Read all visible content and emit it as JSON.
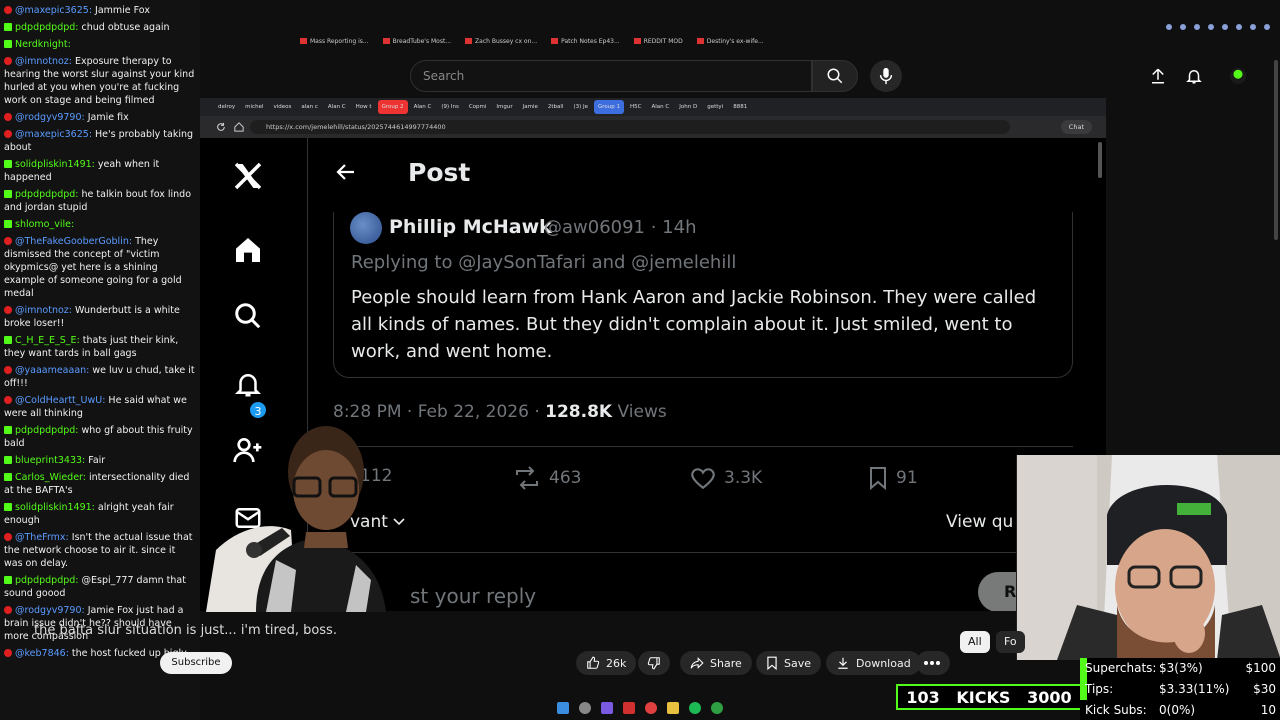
{
  "chat": [
    {
      "platform": "youtube",
      "user": "@maxepic3625:",
      "text": "Jammie Fox",
      "color": "#5b9bff"
    },
    {
      "platform": "kick",
      "user": "pdpdpdpdpd:",
      "text": "chud obtuse again",
      "color": "#53fc18"
    },
    {
      "platform": "kick",
      "user": "Nerdknight:",
      "text": "",
      "color": "#53fc18"
    },
    {
      "platform": "youtube",
      "user": "@imnotnoz:",
      "text": "Exposure therapy to hearing the worst slur against your kind hurled at you when you're at fucking work on stage and being filmed",
      "color": "#5b9bff"
    },
    {
      "platform": "youtube",
      "user": "@rodgyv9790:",
      "text": "Jamie fix",
      "color": "#5b9bff"
    },
    {
      "platform": "youtube",
      "user": "@maxepic3625:",
      "text": "He's probably taking about",
      "color": "#5b9bff"
    },
    {
      "platform": "kick",
      "user": "solidpliskin1491:",
      "text": "yeah when it happened",
      "color": "#53fc18"
    },
    {
      "platform": "kick",
      "user": "pdpdpdpdpd:",
      "text": "he talkin bout fox lindo and jordan stupid",
      "color": "#53fc18"
    },
    {
      "platform": "kick",
      "user": "shlomo_vile:",
      "text": "",
      "color": "#53fc18"
    },
    {
      "platform": "youtube",
      "user": "@TheFakeGooberGoblin:",
      "text": "They dismissed the concept of \"victim okypmics@ yet here is a shining example of someone going for a gold medal",
      "color": "#5b9bff"
    },
    {
      "platform": "youtube",
      "user": "@imnotnoz:",
      "text": "Wunderbutt is a white broke loser!!",
      "color": "#5b9bff"
    },
    {
      "platform": "kick",
      "user": "C_H_E_E_S_E:",
      "text": "thats just their kink, they want tards in ball gags",
      "color": "#53fc18"
    },
    {
      "platform": "youtube",
      "user": "@yaaameaaan:",
      "text": "we luv u chud, take it off!!!",
      "color": "#5b9bff"
    },
    {
      "platform": "youtube",
      "user": "@ColdHeartt_UwU:",
      "text": "He said what we were all thinking",
      "color": "#5b9bff"
    },
    {
      "platform": "kick",
      "user": "pdpdpdpdpd:",
      "text": "who gf about this fruity bald",
      "color": "#53fc18"
    },
    {
      "platform": "kick",
      "user": "blueprint3433:",
      "text": "Fair",
      "color": "#53fc18"
    },
    {
      "platform": "kick",
      "user": "Carlos_Wieder:",
      "text": "intersectionality died at the BAFTA's",
      "color": "#53fc18"
    },
    {
      "platform": "kick",
      "user": "solidpliskin1491:",
      "text": "alright yeah fair enough",
      "color": "#53fc18"
    },
    {
      "platform": "youtube",
      "user": "@TheFrmx:",
      "text": "Isn't the actual issue that the network choose to air it. since it was on delay.",
      "color": "#5b9bff"
    },
    {
      "platform": "kick",
      "user": "pdpdpdpdpd:",
      "text": "@Espi_777 damn that sound goood",
      "color": "#53fc18"
    },
    {
      "platform": "youtube",
      "user": "@rodgyv9790:",
      "text": "Jamie Fox just had a brain issue didn't he?? should have more compassion",
      "color": "#5b9bff"
    },
    {
      "platform": "youtube",
      "user": "@keb7846:",
      "text": "the host fucked up bigly",
      "color": "#5b9bff"
    }
  ],
  "youtube": {
    "search_placeholder": "Search",
    "caption": "the bafta slur situation is just... i'm tired, boss.",
    "subscribe": "Subscribe",
    "likes": "26k",
    "share": "Share",
    "save": "Save",
    "download": "Download",
    "pill_all": "All",
    "pill_fo": "Fo",
    "bookmarks": [
      "Mass Reporting is...",
      "BreadTube's Most...",
      "Zach Bussey cx on...",
      "Patch Notes Ep43...",
      "REDDIT MOD",
      "Destiny's ex-wife..."
    ]
  },
  "browser": {
    "tabs": [
      {
        "label": "delroy",
        "style": ""
      },
      {
        "label": "michel",
        "style": ""
      },
      {
        "label": "videos",
        "style": ""
      },
      {
        "label": "alan c",
        "style": ""
      },
      {
        "label": "Alan C",
        "style": ""
      },
      {
        "label": "How t",
        "style": ""
      },
      {
        "label": "Group 2",
        "style": "grp2"
      },
      {
        "label": "Alan C",
        "style": ""
      },
      {
        "label": "(9) Ins",
        "style": ""
      },
      {
        "label": "Copmi",
        "style": ""
      },
      {
        "label": "Imgur",
        "style": ""
      },
      {
        "label": "Jamie",
        "style": ""
      },
      {
        "label": "2tball",
        "style": ""
      },
      {
        "label": "(3) Je",
        "style": ""
      },
      {
        "label": "Group 1",
        "style": "grp3"
      },
      {
        "label": "H5C",
        "style": ""
      },
      {
        "label": "Alan C",
        "style": ""
      },
      {
        "label": "John D",
        "style": ""
      },
      {
        "label": "gettyi",
        "style": ""
      },
      {
        "label": "8881",
        "style": ""
      }
    ],
    "url": "https://x.com/jemelehill/status/2025744614997774400",
    "chat_label": "Chat"
  },
  "x": {
    "notification_count": "3",
    "page_title": "Post",
    "quoted": {
      "name": "Phillip McHawk",
      "handle": "@aw06091 · 14h",
      "replying_to": "Replying to @JaySonTafari and @jemelehill",
      "text": "People should learn from Hank Aaron and Jackie Robinson. They were called all kinds of names. But they didn't complain about it. Just smiled, went to work, and went home."
    },
    "time": "8:28 PM · Feb 22, 2026 ·",
    "views_count": "128.8K",
    "views_label": "Views",
    "replies": "112",
    "reposts": "463",
    "likes": "3.3K",
    "bookmarks": "91",
    "sort_label": "vant",
    "view_quotes": "View qu",
    "reply_placeholder": "st your reply",
    "reply_button": "Re"
  },
  "overlay": {
    "count": "103",
    "kicks_label": "KICKS",
    "kicks_goal": "3000",
    "superchats": {
      "label": "Superchats:",
      "value": "$3(3%)",
      "goal": "$100"
    },
    "tips": {
      "label": "Tips:",
      "value": "$3.33(11%)",
      "goal": "$30"
    },
    "kick_subs": {
      "label": "Kick Subs:",
      "value": "0(0%)",
      "goal": "10"
    }
  },
  "colors": {
    "kick_green": "#53fc18",
    "x_blue": "#1d9bf0",
    "yt_red": "#e02020"
  }
}
